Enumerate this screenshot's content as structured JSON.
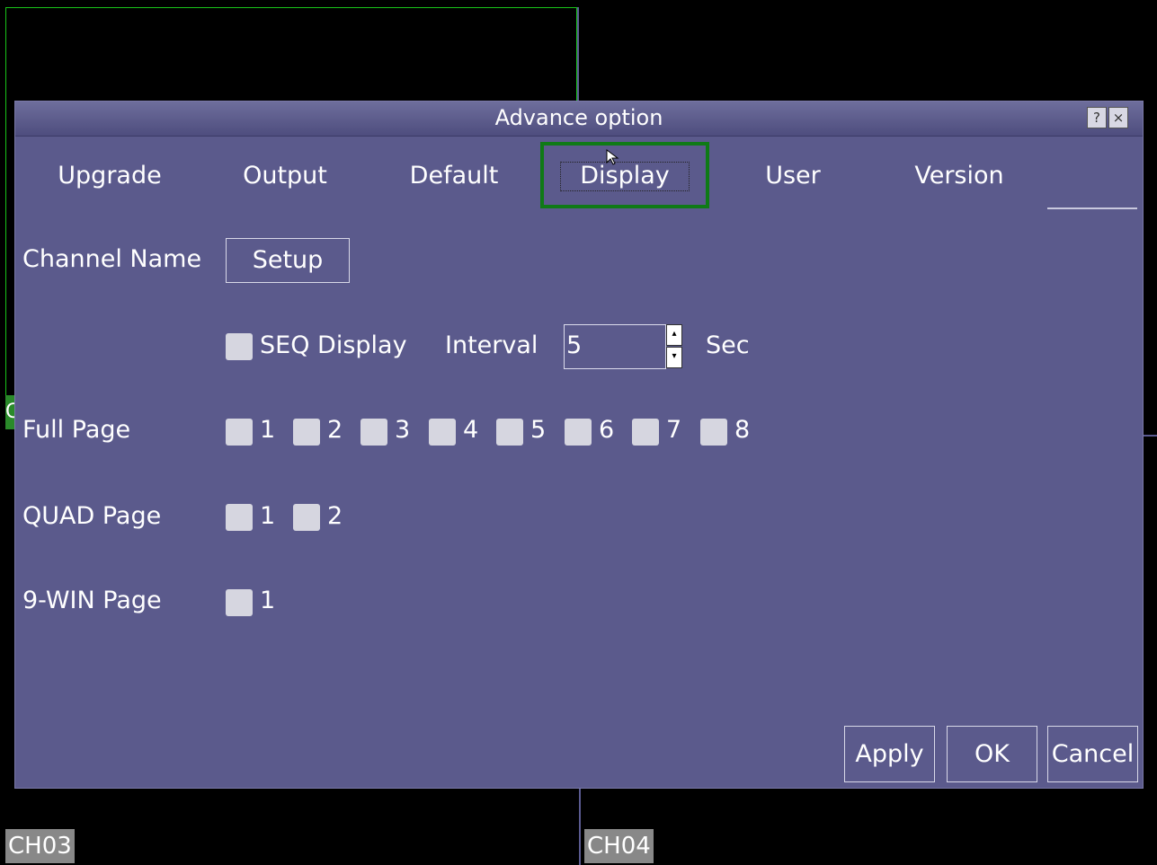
{
  "background_channels": {
    "bottom_left_label": "CH03",
    "bottom_right_label": "CH04",
    "left_stub_label": "C"
  },
  "dialog": {
    "title": "Advance option",
    "help_button": "?",
    "close_button": "×",
    "tabs": [
      {
        "label": "Upgrade"
      },
      {
        "label": "Output"
      },
      {
        "label": "Default"
      },
      {
        "label": "Display",
        "active": true
      },
      {
        "label": "User"
      },
      {
        "label": "Version"
      }
    ],
    "channel_name": {
      "label": "Channel Name",
      "button": "Setup"
    },
    "seq": {
      "label": "SEQ Display",
      "checked": false,
      "interval_label": "Interval",
      "interval_value": "5",
      "unit": "Sec"
    },
    "full_page": {
      "label": "Full Page",
      "options": [
        "1",
        "2",
        "3",
        "4",
        "5",
        "6",
        "7",
        "8"
      ]
    },
    "quad_page": {
      "label": "QUAD Page",
      "options": [
        "1",
        "2"
      ]
    },
    "win9_page": {
      "label": "9-WIN Page",
      "options": [
        "1"
      ]
    },
    "buttons": {
      "apply": "Apply",
      "ok": "OK",
      "cancel": "Cancel"
    },
    "accent_colors": {
      "dialog_bg": "#5b5a8c",
      "active_tab_outline": "#0f7a16",
      "checkbox": "#d6d6e0"
    }
  }
}
